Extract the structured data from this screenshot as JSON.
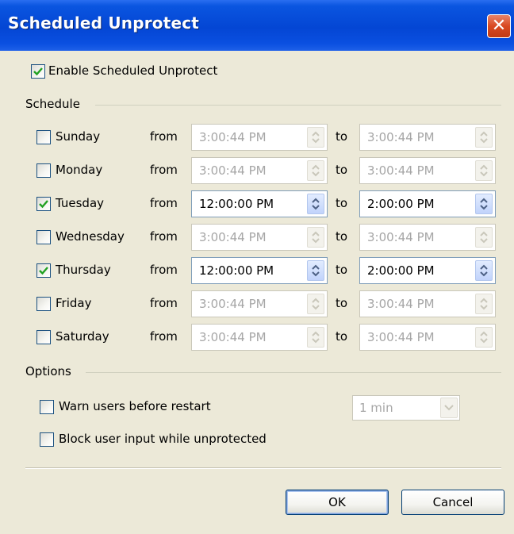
{
  "window": {
    "title": "Scheduled Unprotect",
    "close_icon": "close-icon"
  },
  "enable": {
    "label": "Enable Scheduled Unprotect",
    "checked": true
  },
  "schedule": {
    "label": "Schedule",
    "from_label": "from",
    "to_label": "to",
    "days": [
      {
        "day": "Sunday",
        "checked": false,
        "from": "3:00:44 PM",
        "to": "3:00:44 PM"
      },
      {
        "day": "Monday",
        "checked": false,
        "from": "3:00:44 PM",
        "to": "3:00:44 PM"
      },
      {
        "day": "Tuesday",
        "checked": true,
        "from": "12:00:00 PM",
        "to": "2:00:00 PM"
      },
      {
        "day": "Wednesday",
        "checked": false,
        "from": "3:00:44 PM",
        "to": "3:00:44 PM"
      },
      {
        "day": "Thursday",
        "checked": true,
        "from": "12:00:00 PM",
        "to": "2:00:00 PM"
      },
      {
        "day": "Friday",
        "checked": false,
        "from": "3:00:44 PM",
        "to": "3:00:44 PM"
      },
      {
        "day": "Saturday",
        "checked": false,
        "from": "3:00:44 PM",
        "to": "3:00:44 PM"
      }
    ]
  },
  "options": {
    "label": "Options",
    "warn": {
      "label": "Warn users before restart",
      "checked": false,
      "select_value": "1 min"
    },
    "block": {
      "label": "Block user input while unprotected",
      "checked": false
    }
  },
  "buttons": {
    "ok": "OK",
    "cancel": "Cancel"
  },
  "colors": {
    "title_bar": "#0446d4",
    "dialog_bg": "#ece9d8",
    "close": "#d94a22",
    "check": "#21a121"
  }
}
